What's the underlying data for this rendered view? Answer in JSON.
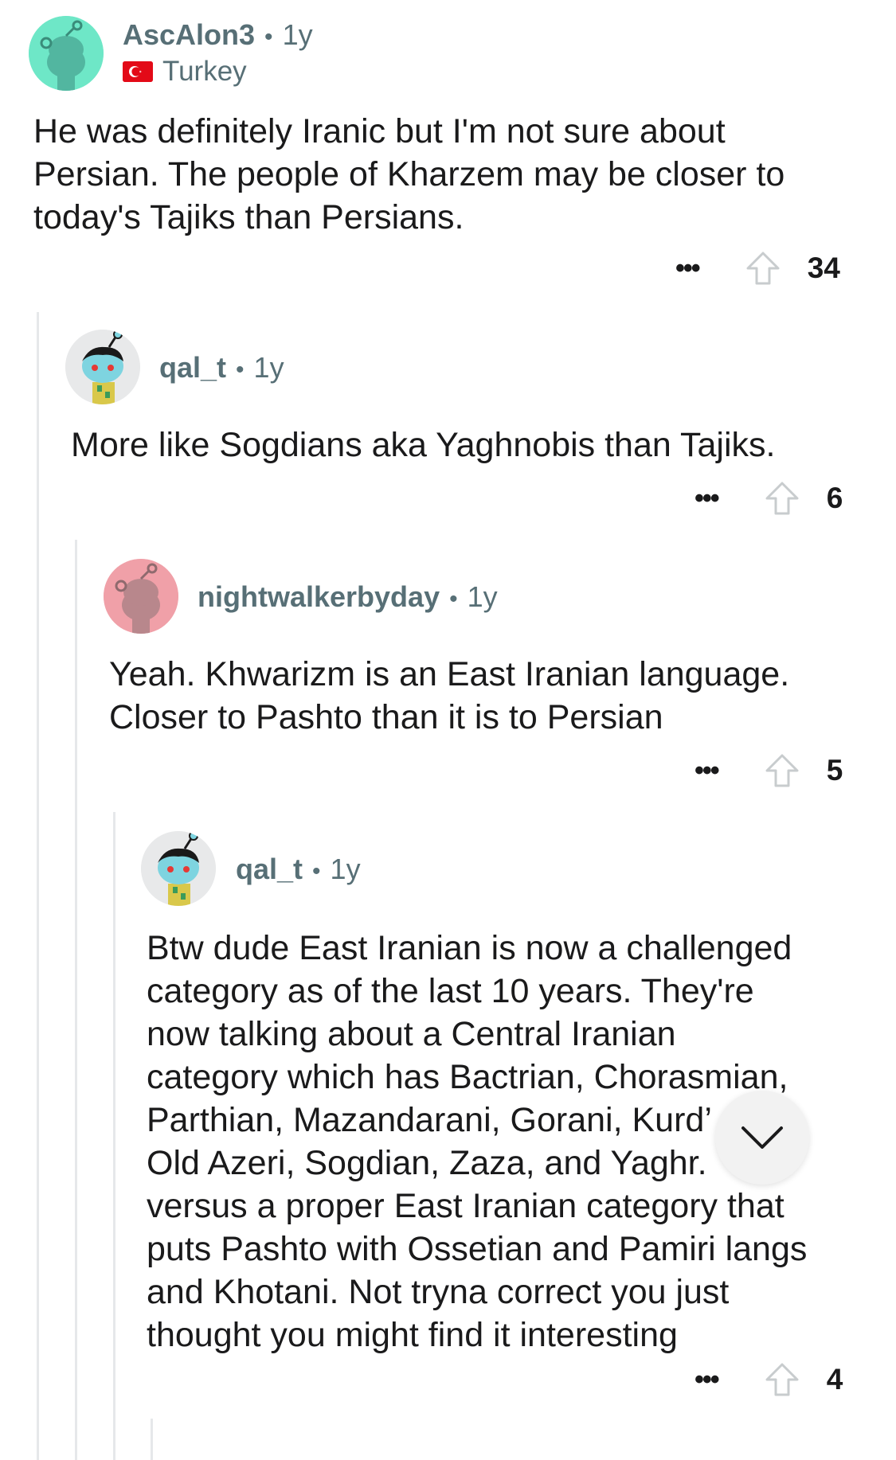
{
  "comments": [
    {
      "username": "AscAlon3",
      "age": "1y",
      "flair": "Turkey",
      "body": "He was definitely Iranic but I'm not sure about\nPersian.  The people of Kharzem may be closer to\ntoday's Tajiks than Persians.",
      "score": "34",
      "avatar_color": "#6ee7c7"
    },
    {
      "username": "qal_t",
      "age": "1y",
      "body": "More like Sogdians aka Yaghnobis than Tajiks.",
      "score": "6",
      "avatar_color": "#e8e9ea"
    },
    {
      "username": "nightwalkerbyday",
      "age": "1y",
      "body": "Yeah. Khwarizm is an East Iranian language.\nCloser to Pashto than it is to Persian",
      "score": "5",
      "avatar_color": "#f0a0a8"
    },
    {
      "username": "qal_t",
      "age": "1y",
      "body": "Btw dude East Iranian is now a challenged\ncategory as of the last 10 years. They're\nnow talking about a Central Iranian\ncategory which has Bactrian, Chorasmian,\nParthian, Mazandarani, Gorani, Kurd’\nOld Azeri, Sogdian, Zaza, and Yaghr.\nversus a proper East Iranian category that\nputs Pashto with Ossetian and Pamiri langs\nand Khotani. Not tryna correct you just\nthought you might find it interesting",
      "score": "4",
      "avatar_color": "#e8e9ea"
    }
  ],
  "separator": "•",
  "more_label": "•••",
  "icons": {
    "more": "more-options-icon",
    "upvote": "upvote-arrow-icon",
    "scroll": "chevron-down-icon"
  },
  "colors": {
    "meta_gray": "#576f76",
    "thread_line": "#e6e8ea",
    "flag_red": "#e30a17"
  }
}
